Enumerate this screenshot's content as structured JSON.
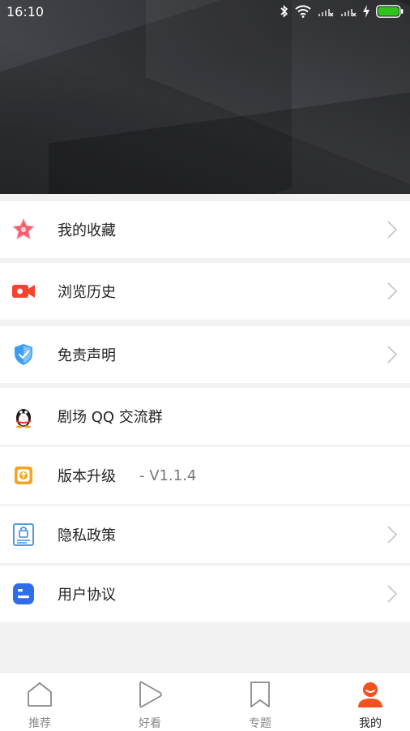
{
  "status_bar": {
    "time": "16:10",
    "icons": [
      "bluetooth-icon",
      "wifi-icon",
      "signal-1-icon",
      "signal-2-icon",
      "charging-icon",
      "battery-icon"
    ],
    "battery_color": "#2fc41a"
  },
  "menu": [
    {
      "label": "我的收藏",
      "value": "",
      "icon": "star-icon"
    },
    {
      "label": "浏览历史",
      "value": "",
      "icon": "video-camera-icon"
    },
    {
      "label": "免责声明",
      "value": "",
      "icon": "shield-check-icon"
    },
    {
      "label": "剧场 QQ 交流群",
      "value": "",
      "icon": "qq-penguin-icon"
    },
    {
      "label": "版本升级",
      "value": "-  V1.1.4",
      "icon": "upgrade-icon"
    },
    {
      "label": "隐私政策",
      "value": "",
      "icon": "privacy-lock-icon"
    },
    {
      "label": "用户协议",
      "value": "",
      "icon": "agreement-icon"
    }
  ],
  "bottom_nav": [
    {
      "label": "推荐",
      "icon": "home-icon",
      "active": false
    },
    {
      "label": "好看",
      "icon": "play-icon",
      "active": false
    },
    {
      "label": "专题",
      "icon": "bookmark-icon",
      "active": false
    },
    {
      "label": "我的",
      "icon": "profile-icon",
      "active": true
    }
  ],
  "colors": {
    "accent": "#f4511e",
    "star": "#f25c6b",
    "video": "#f4432f",
    "shield": "#3a9df0",
    "upgrade": "#f2a621",
    "privacy": "#3f8fe0",
    "agreement": "#2f6ee8",
    "nav_inactive": "#8a8a8a"
  }
}
